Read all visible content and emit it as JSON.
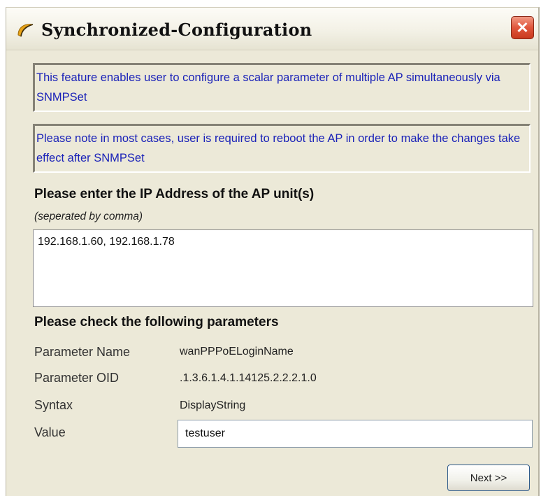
{
  "window": {
    "title": "Synchronized-Configuration",
    "app_icon": "swoosh-logo-icon",
    "close_icon": "close-icon",
    "close_glyph": "✕",
    "close_color": "#e0563c"
  },
  "notices": {
    "feature": "This feature enables user to configure a scalar parameter of multiple AP simultaneously via SNMPSet",
    "reboot": "Please note in most cases, user is required to reboot the AP in order to make the changes take effect after SNMPSet",
    "text_color": "#1a22b8"
  },
  "ip_section": {
    "heading": "Please enter the IP Address of the AP unit(s)",
    "hint": "(seperated by comma)",
    "value": "192.168.1.60, 192.168.1.78"
  },
  "params_section": {
    "heading": "Please check the following parameters",
    "rows": [
      {
        "label": "Parameter Name",
        "value": "wanPPPoELoginName"
      },
      {
        "label": "Parameter OID",
        "value": ".1.3.6.1.4.1.14125.2.2.2.1.0"
      },
      {
        "label": "Syntax",
        "value": "DisplayString"
      },
      {
        "label": "Value",
        "value": "testuser"
      }
    ]
  },
  "buttons": {
    "next": "Next >>"
  }
}
